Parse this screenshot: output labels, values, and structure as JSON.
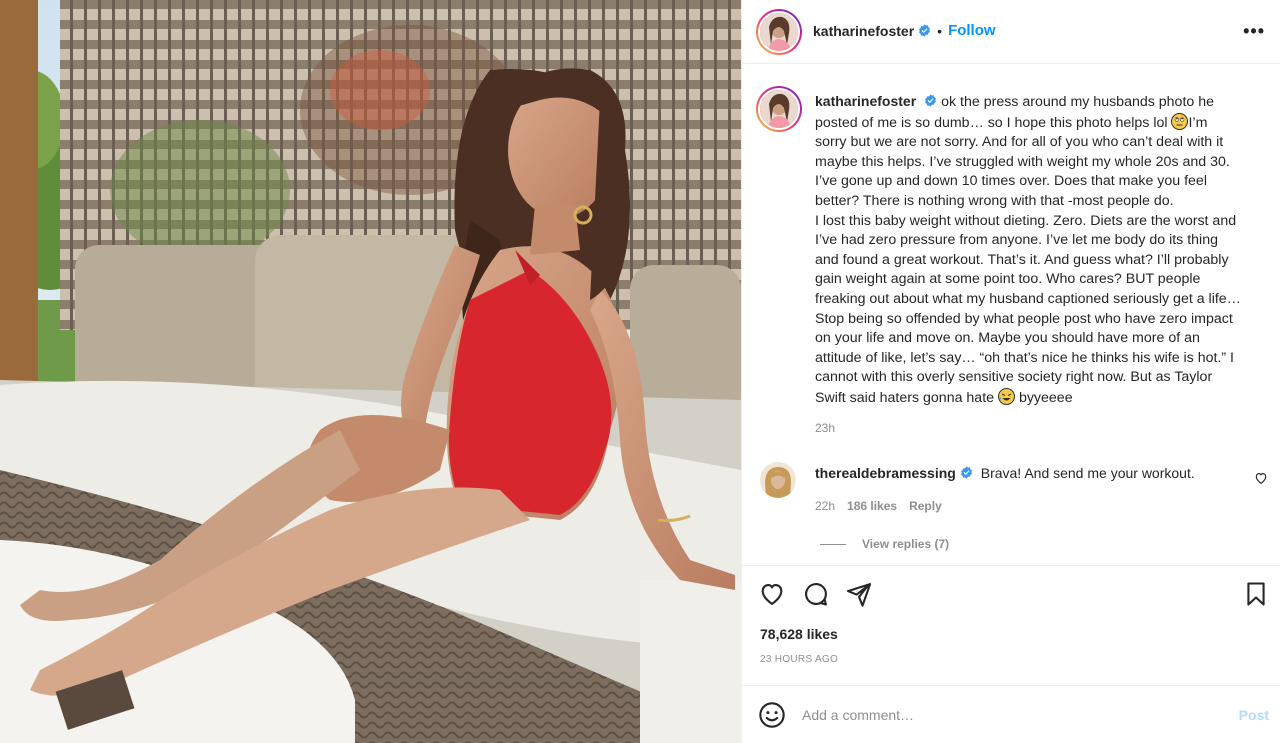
{
  "post": {
    "author": "katharinefoster",
    "follow_label": "Follow",
    "separator": "•",
    "more_label": "•••",
    "caption_lines": [
      "posted of me is so dumb… so I hope this photo helps lol",
      "sorry but we are not sorry. And for all of you who can’t deal with it",
      "maybe this helps. I’ve struggled with weight my whole 20s and 30.",
      "I’ve gone up and down 10 times over. Does that make you feel",
      "better? There is nothing wrong with that -most people do.",
      "I lost this baby weight without dieting. Zero. Diets are the worst and",
      "I’ve had zero pressure from anyone. I’ve let me body do its thing",
      "and found a great workout. That’s it. And guess what? I’ll probably",
      "gain weight again at some point too. Who cares? BUT people",
      "freaking out about what my husband captioned seriously get a life…",
      "Stop being so offended by what people post who have zero impact",
      "on your life and move on. Maybe you should have more of an",
      "attitude of like, let’s say… “oh that’s nice he thinks his wife is hot.” I",
      "cannot with this overly sensitive society right now. But as Taylor",
      "Swift said haters gonna hate"
    ],
    "caption_first": "ok the press around my husbands photo he",
    "caption_after_emoji1": "I’m",
    "caption_end": "byyeeee",
    "caption_time": "23h",
    "likes": "78,628 likes",
    "posted_ago": "23 HOURS AGO"
  },
  "comments": [
    {
      "user": "therealdebramessing",
      "text": "Brava! And send me your workout.",
      "time": "22h",
      "likes": "186 likes",
      "reply_label": "Reply",
      "view_replies": "View replies (7)"
    }
  ],
  "composer": {
    "placeholder": "Add a comment…",
    "post_label": "Post"
  },
  "icons": {
    "like": "heart-icon",
    "comment": "comment-icon",
    "share": "paper-plane-icon",
    "save": "bookmark-icon",
    "emoji": "smiley-icon",
    "verified": "verified-badge-icon",
    "more": "more-options-icon"
  },
  "colors": {
    "accent": "#0095f6",
    "post_disabled": "#b3dbff",
    "verified": "#3897f0",
    "swimsuit": "#d8262e"
  }
}
